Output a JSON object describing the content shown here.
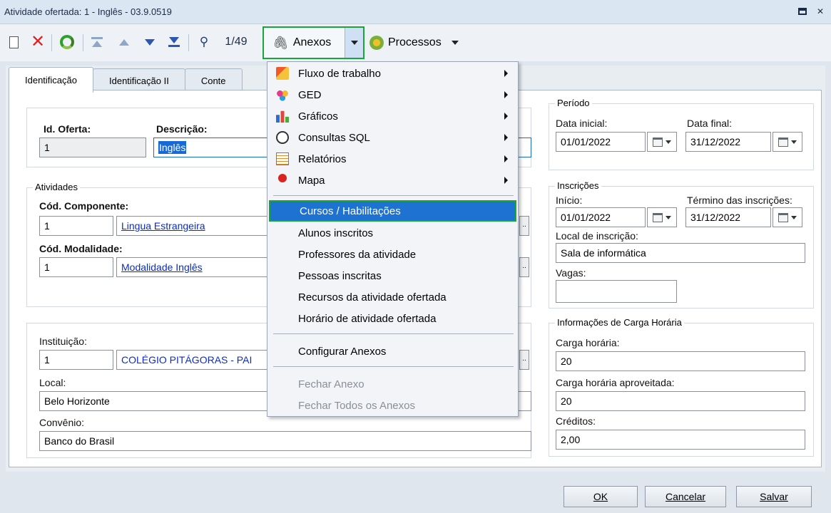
{
  "window": {
    "title": "Atividade ofertada: 1 - Inglês - 03.9.0519",
    "restore_icon": "restore-icon",
    "close_glyph": "✕"
  },
  "toolbar": {
    "counter": "1/49",
    "anexos_label": "Anexos",
    "processos_label": "Processos"
  },
  "tabs": [
    {
      "label": "Identificação",
      "active": true
    },
    {
      "label": "Identificação II",
      "active": false
    },
    {
      "label": "Conte",
      "active": false
    }
  ],
  "oferta": {
    "id_label": "Id. Oferta:",
    "id_value": "1",
    "desc_label": "Descrição:",
    "desc_value": "Inglês"
  },
  "atividades": {
    "title": "Atividades",
    "comp_label": "Cód. Componente:",
    "comp_code": "1",
    "comp_name": "Lingua Estrangeira",
    "mod_label": "Cód. Modalidade:",
    "mod_code": "1",
    "mod_name": "Modalidade Inglês"
  },
  "instituicao": {
    "label": "Instituição:",
    "code": "1",
    "name": "COLÉGIO PITÁGORAS - PAI",
    "local_label": "Local:",
    "local_value": "Belo Horizonte",
    "convenio_label": "Convênio:",
    "convenio_value": "Banco do Brasil"
  },
  "periodo": {
    "title": "Período",
    "inicial_label": "Data inicial:",
    "inicial_value": "01/01/2022",
    "final_label": "Data final:",
    "final_value": "31/12/2022"
  },
  "inscricoes": {
    "title": "Inscrições",
    "inicio_label": "Início:",
    "inicio_value": "01/01/2022",
    "termino_label": "Término das inscrições:",
    "termino_value": "31/12/2022",
    "local_label": "Local de inscrição:",
    "local_value": "Sala de informática",
    "vagas_label": "Vagas:",
    "vagas_value": ""
  },
  "carga": {
    "title": "Informações de Carga Horária",
    "ch_label": "Carga horária:",
    "ch_value": "20",
    "cha_label": "Carga horária aproveitada:",
    "cha_value": "20",
    "cred_label": "Créditos:",
    "cred_value": "2,00"
  },
  "menu": {
    "fluxo": "Fluxo de trabalho",
    "ged": "GED",
    "graficos": "Gráficos",
    "consultas": "Consultas SQL",
    "relatorios": "Relatórios",
    "mapa": "Mapa",
    "cursos": "Cursos / Habilitações",
    "alunos": "Alunos inscritos",
    "professores": "Professores da atividade",
    "pessoas": "Pessoas inscritas",
    "recursos": "Recursos da atividade ofertada",
    "horario": "Horário de atividade ofertada",
    "configurar": "Configurar Anexos",
    "fechar": "Fechar Anexo",
    "fechar_todos": "Fechar Todos os Anexos"
  },
  "footer": {
    "ok": "OK",
    "cancelar": "Cancelar",
    "salvar": "Salvar"
  },
  "colors": {
    "highlight": "#1e73d2",
    "focus_border": "#18a53b",
    "link": "#0a2ccc"
  }
}
